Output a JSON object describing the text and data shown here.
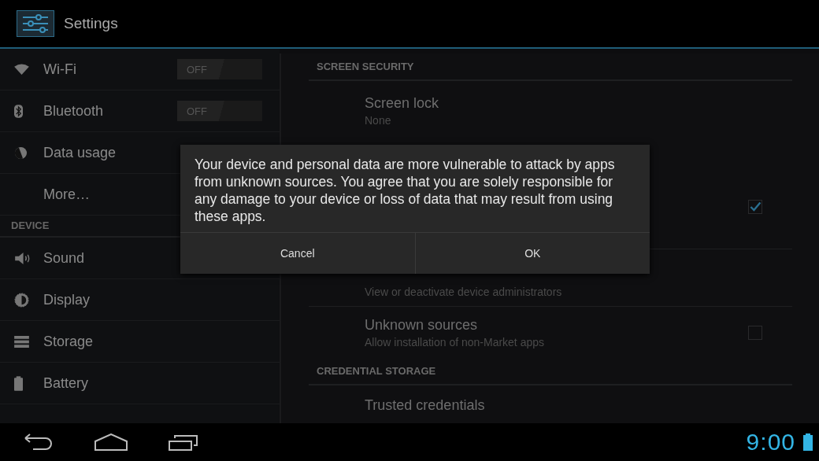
{
  "action_bar": {
    "title": "Settings"
  },
  "sidebar": {
    "items": [
      {
        "kind": "toggle",
        "label": "Wi-Fi",
        "toggle": {
          "label": "OFF",
          "on": false
        }
      },
      {
        "kind": "toggle",
        "label": "Bluetooth",
        "toggle": {
          "label": "OFF",
          "on": false
        }
      },
      {
        "kind": "item",
        "label": "Data usage"
      },
      {
        "kind": "item",
        "label": "More…"
      },
      {
        "kind": "header",
        "label": "DEVICE"
      },
      {
        "kind": "item",
        "label": "Sound"
      },
      {
        "kind": "item",
        "label": "Display"
      },
      {
        "kind": "item",
        "label": "Storage"
      },
      {
        "kind": "item",
        "label": "Battery"
      }
    ]
  },
  "security": {
    "items": [
      {
        "kind": "header",
        "label": "SCREEN SECURITY"
      },
      {
        "kind": "item",
        "title": "Screen lock",
        "subtitle": "None"
      },
      {
        "kind": "checkbox",
        "checked": true
      },
      {
        "kind": "item",
        "subtitle": "View or deactivate device administrators"
      },
      {
        "kind": "checkbox",
        "title": "Unknown sources",
        "subtitle": "Allow installation of non-Market apps",
        "checked": false
      },
      {
        "kind": "header",
        "label": "CREDENTIAL STORAGE"
      },
      {
        "kind": "item",
        "title": "Trusted credentials"
      }
    ]
  },
  "dialog": {
    "message": "Your device and personal data are more vulnerable to attack by apps from unknown sources. You agree that you are solely responsible for any damage to your device or loss of data that may result from using these apps.",
    "buttons": [
      "Cancel",
      "OK"
    ]
  },
  "nav_bar": {
    "clock": "9:00"
  }
}
